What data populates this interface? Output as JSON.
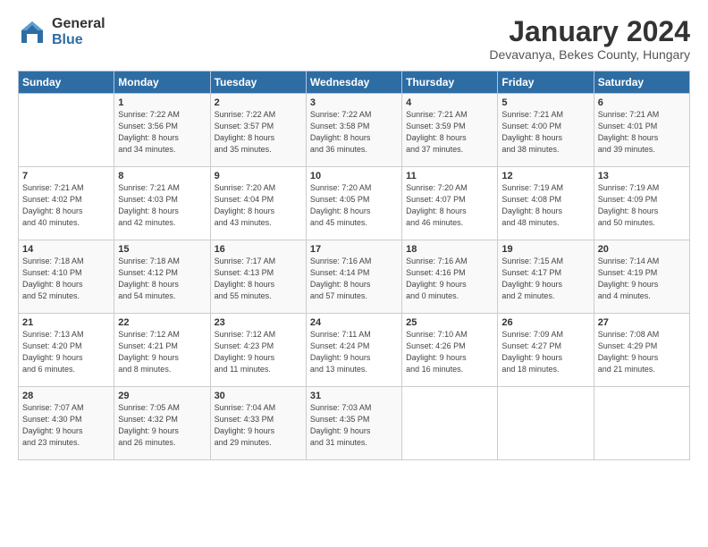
{
  "logo": {
    "general": "General",
    "blue": "Blue"
  },
  "title": "January 2024",
  "location": "Devavanya, Bekes County, Hungary",
  "days_of_week": [
    "Sunday",
    "Monday",
    "Tuesday",
    "Wednesday",
    "Thursday",
    "Friday",
    "Saturday"
  ],
  "weeks": [
    [
      {
        "day": "",
        "info": ""
      },
      {
        "day": "1",
        "info": "Sunrise: 7:22 AM\nSunset: 3:56 PM\nDaylight: 8 hours\nand 34 minutes."
      },
      {
        "day": "2",
        "info": "Sunrise: 7:22 AM\nSunset: 3:57 PM\nDaylight: 8 hours\nand 35 minutes."
      },
      {
        "day": "3",
        "info": "Sunrise: 7:22 AM\nSunset: 3:58 PM\nDaylight: 8 hours\nand 36 minutes."
      },
      {
        "day": "4",
        "info": "Sunrise: 7:21 AM\nSunset: 3:59 PM\nDaylight: 8 hours\nand 37 minutes."
      },
      {
        "day": "5",
        "info": "Sunrise: 7:21 AM\nSunset: 4:00 PM\nDaylight: 8 hours\nand 38 minutes."
      },
      {
        "day": "6",
        "info": "Sunrise: 7:21 AM\nSunset: 4:01 PM\nDaylight: 8 hours\nand 39 minutes."
      }
    ],
    [
      {
        "day": "7",
        "info": "Sunrise: 7:21 AM\nSunset: 4:02 PM\nDaylight: 8 hours\nand 40 minutes."
      },
      {
        "day": "8",
        "info": "Sunrise: 7:21 AM\nSunset: 4:03 PM\nDaylight: 8 hours\nand 42 minutes."
      },
      {
        "day": "9",
        "info": "Sunrise: 7:20 AM\nSunset: 4:04 PM\nDaylight: 8 hours\nand 43 minutes."
      },
      {
        "day": "10",
        "info": "Sunrise: 7:20 AM\nSunset: 4:05 PM\nDaylight: 8 hours\nand 45 minutes."
      },
      {
        "day": "11",
        "info": "Sunrise: 7:20 AM\nSunset: 4:07 PM\nDaylight: 8 hours\nand 46 minutes."
      },
      {
        "day": "12",
        "info": "Sunrise: 7:19 AM\nSunset: 4:08 PM\nDaylight: 8 hours\nand 48 minutes."
      },
      {
        "day": "13",
        "info": "Sunrise: 7:19 AM\nSunset: 4:09 PM\nDaylight: 8 hours\nand 50 minutes."
      }
    ],
    [
      {
        "day": "14",
        "info": "Sunrise: 7:18 AM\nSunset: 4:10 PM\nDaylight: 8 hours\nand 52 minutes."
      },
      {
        "day": "15",
        "info": "Sunrise: 7:18 AM\nSunset: 4:12 PM\nDaylight: 8 hours\nand 54 minutes."
      },
      {
        "day": "16",
        "info": "Sunrise: 7:17 AM\nSunset: 4:13 PM\nDaylight: 8 hours\nand 55 minutes."
      },
      {
        "day": "17",
        "info": "Sunrise: 7:16 AM\nSunset: 4:14 PM\nDaylight: 8 hours\nand 57 minutes."
      },
      {
        "day": "18",
        "info": "Sunrise: 7:16 AM\nSunset: 4:16 PM\nDaylight: 9 hours\nand 0 minutes."
      },
      {
        "day": "19",
        "info": "Sunrise: 7:15 AM\nSunset: 4:17 PM\nDaylight: 9 hours\nand 2 minutes."
      },
      {
        "day": "20",
        "info": "Sunrise: 7:14 AM\nSunset: 4:19 PM\nDaylight: 9 hours\nand 4 minutes."
      }
    ],
    [
      {
        "day": "21",
        "info": "Sunrise: 7:13 AM\nSunset: 4:20 PM\nDaylight: 9 hours\nand 6 minutes."
      },
      {
        "day": "22",
        "info": "Sunrise: 7:12 AM\nSunset: 4:21 PM\nDaylight: 9 hours\nand 8 minutes."
      },
      {
        "day": "23",
        "info": "Sunrise: 7:12 AM\nSunset: 4:23 PM\nDaylight: 9 hours\nand 11 minutes."
      },
      {
        "day": "24",
        "info": "Sunrise: 7:11 AM\nSunset: 4:24 PM\nDaylight: 9 hours\nand 13 minutes."
      },
      {
        "day": "25",
        "info": "Sunrise: 7:10 AM\nSunset: 4:26 PM\nDaylight: 9 hours\nand 16 minutes."
      },
      {
        "day": "26",
        "info": "Sunrise: 7:09 AM\nSunset: 4:27 PM\nDaylight: 9 hours\nand 18 minutes."
      },
      {
        "day": "27",
        "info": "Sunrise: 7:08 AM\nSunset: 4:29 PM\nDaylight: 9 hours\nand 21 minutes."
      }
    ],
    [
      {
        "day": "28",
        "info": "Sunrise: 7:07 AM\nSunset: 4:30 PM\nDaylight: 9 hours\nand 23 minutes."
      },
      {
        "day": "29",
        "info": "Sunrise: 7:05 AM\nSunset: 4:32 PM\nDaylight: 9 hours\nand 26 minutes."
      },
      {
        "day": "30",
        "info": "Sunrise: 7:04 AM\nSunset: 4:33 PM\nDaylight: 9 hours\nand 29 minutes."
      },
      {
        "day": "31",
        "info": "Sunrise: 7:03 AM\nSunset: 4:35 PM\nDaylight: 9 hours\nand 31 minutes."
      },
      {
        "day": "",
        "info": ""
      },
      {
        "day": "",
        "info": ""
      },
      {
        "day": "",
        "info": ""
      }
    ]
  ]
}
